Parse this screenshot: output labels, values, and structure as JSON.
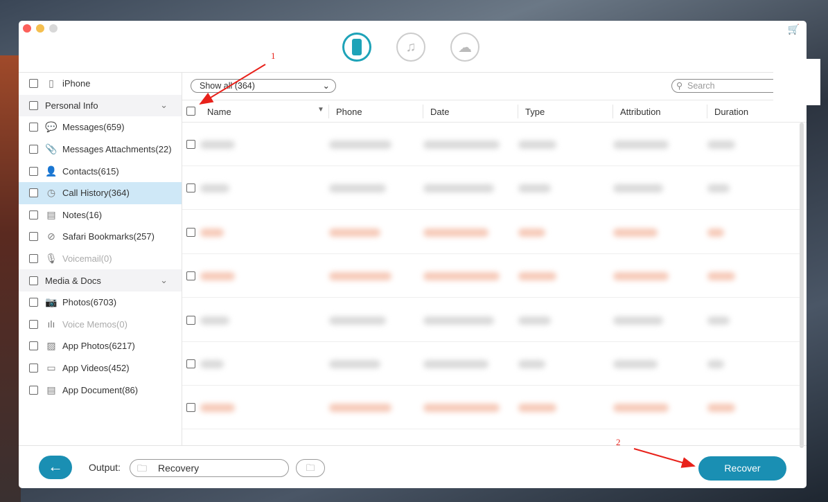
{
  "toolbar": {
    "modes": [
      {
        "name": "recover-from-device",
        "active": true
      },
      {
        "name": "recover-from-itunes",
        "active": false
      },
      {
        "name": "recover-from-icloud",
        "active": false
      }
    ]
  },
  "sidebar": {
    "device": "iPhone",
    "groups": [
      {
        "label": "Personal Info",
        "items": [
          {
            "label": "Messages(659)",
            "icon": "message-icon"
          },
          {
            "label": "Messages Attachments(22)",
            "icon": "paperclip-icon"
          },
          {
            "label": "Contacts(615)",
            "icon": "person-icon"
          },
          {
            "label": "Call History(364)",
            "icon": "clock-icon",
            "selected": true
          },
          {
            "label": "Notes(16)",
            "icon": "notes-icon"
          },
          {
            "label": "Safari Bookmarks(257)",
            "icon": "compass-icon"
          },
          {
            "label": "Voicemail(0)",
            "icon": "microphone-icon",
            "disabled": true
          }
        ]
      },
      {
        "label": "Media & Docs",
        "items": [
          {
            "label": "Photos(6703)",
            "icon": "camera-icon"
          },
          {
            "label": "Voice Memos(0)",
            "icon": "waveform-icon",
            "disabled": true
          },
          {
            "label": "App Photos(6217)",
            "icon": "image-icon"
          },
          {
            "label": "App Videos(452)",
            "icon": "video-icon"
          },
          {
            "label": "App Document(86)",
            "icon": "document-icon"
          }
        ]
      }
    ]
  },
  "main": {
    "filter": "Show all (364)",
    "search_placeholder": "Search",
    "columns": [
      "Name",
      "Phone",
      "Date",
      "Type",
      "Attribution",
      "Duration"
    ],
    "rows": 7
  },
  "footer": {
    "output_label": "Output:",
    "output_value": "Recovery",
    "recover_label": "Recover"
  },
  "annotations": [
    "1",
    "2"
  ],
  "colors": {
    "accent": "#1a8fb3",
    "selected": "#cfe8f7",
    "annotation": "#e8211a"
  }
}
